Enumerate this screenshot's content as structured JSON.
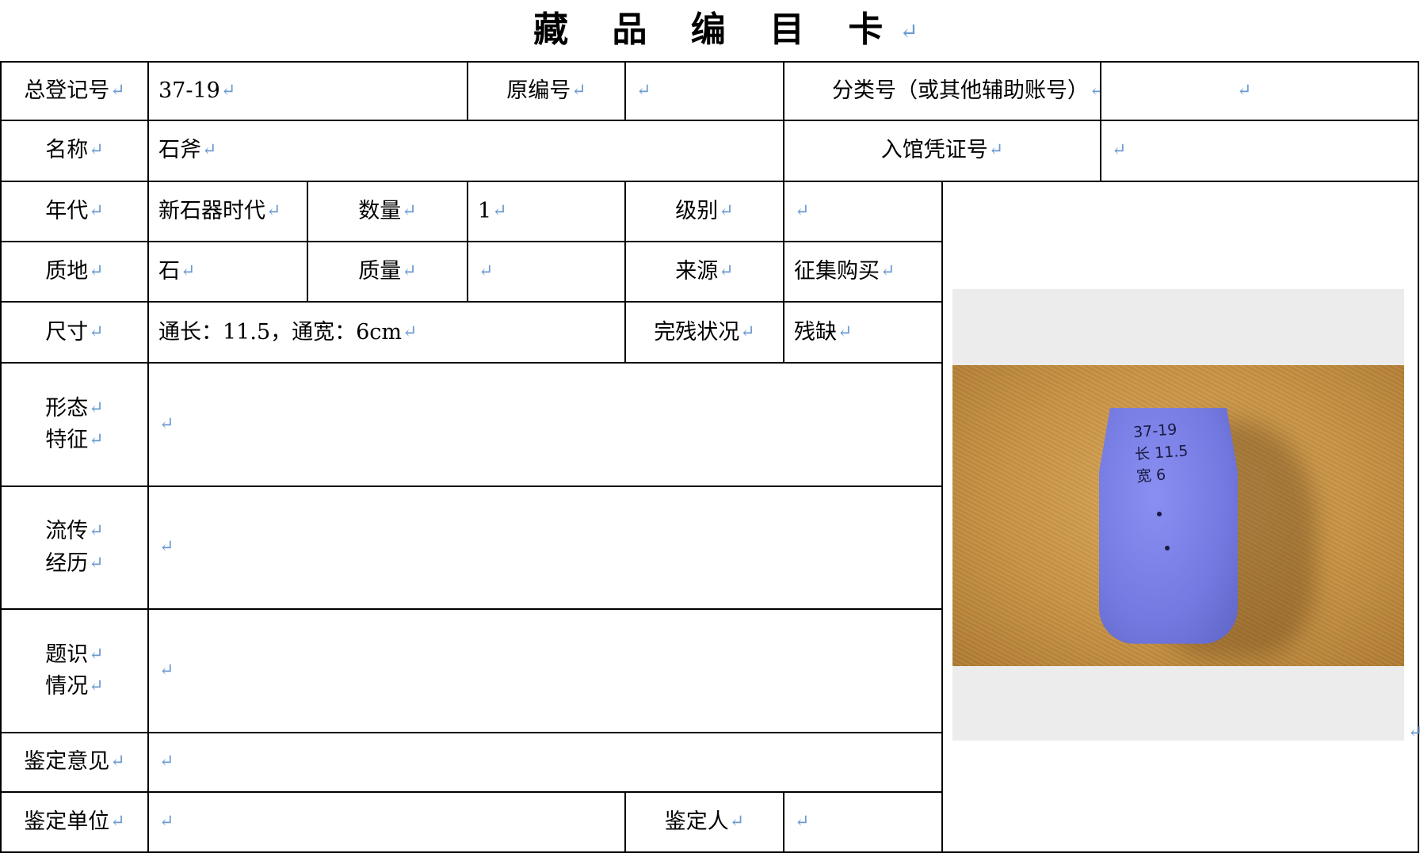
{
  "title": "藏 品 编 目 卡",
  "return_mark": "↵",
  "fields": {
    "total_reg_label": "总登记号",
    "total_reg_value": "37-19",
    "orig_no_label": "原编号",
    "orig_no_value": "",
    "class_no_label": "分类号（或其他辅助账号）",
    "class_no_value": "",
    "name_label": "名称",
    "name_value": "石斧",
    "entry_voucher_label": "入馆凭证号",
    "entry_voucher_value": "",
    "era_label": "年代",
    "era_value": "新石器时代",
    "quantity_label": "数量",
    "quantity_value": "1",
    "grade_label": "级别",
    "grade_value": "",
    "material_label": "质地",
    "material_value": "石",
    "mass_label": "质量",
    "mass_value": "",
    "source_label": "来源",
    "source_value": "征集购买",
    "size_label": "尺寸",
    "size_value": "通长：11.5，通宽：6cm",
    "condition_label": "完残状况",
    "condition_value": "残缺",
    "morph_label_1": "形态",
    "morph_label_2": "特征",
    "morph_value": "",
    "history_label_1": "流传",
    "history_label_2": "经历",
    "history_value": "",
    "inscr_label_1": "题识",
    "inscr_label_2": "情况",
    "inscr_value": "",
    "appraisal_opinion_label": "鉴定意见",
    "appraisal_opinion_value": "",
    "appraisal_unit_label": "鉴定单位",
    "appraisal_unit_value": "",
    "appraiser_label": "鉴定人",
    "appraiser_value": ""
  },
  "photo": {
    "marking_text": "37-19\n长 11.5\n宽 6",
    "axe_color": "#7379e0",
    "ground_color": "#c99445"
  }
}
